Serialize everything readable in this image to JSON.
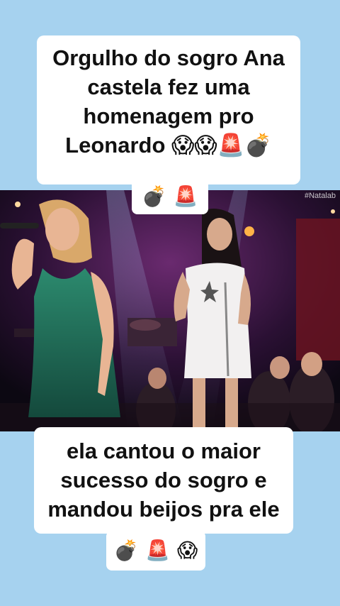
{
  "caption_top": {
    "lines": [
      "Orgulho do sogro Ana",
      "castela fez uma",
      "homenagem pro",
      "Leonardo 😱😱🚨💣"
    ],
    "tail": "💣 🚨"
  },
  "video": {
    "watermark": "#Natalab"
  },
  "caption_bottom": {
    "lines": [
      "ela cantou o maior",
      "sucesso do sogro e",
      "mandou beijos pra ele"
    ],
    "tail": "💣 🚨 😱"
  },
  "colors": {
    "background": "#a6d2ef",
    "caption_bg": "#ffffff",
    "caption_text": "#111111",
    "dress_green": "#1f6b55",
    "dress_white": "#f2f0f0"
  }
}
